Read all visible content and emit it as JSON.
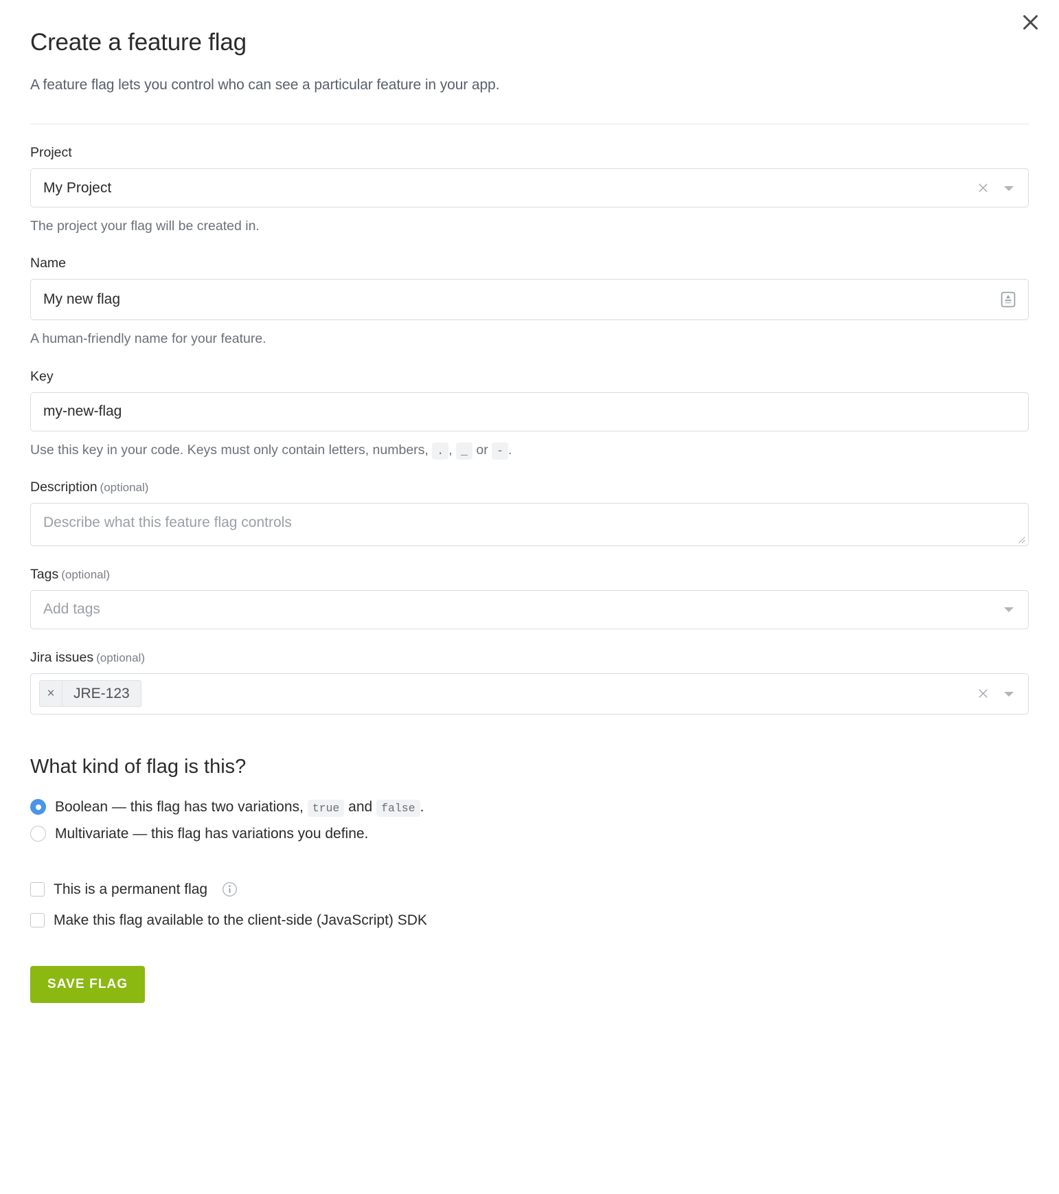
{
  "dialog": {
    "title": "Create a feature flag",
    "subtitle": "A feature flag lets you control who can see a particular feature in your app.",
    "close_label": "close-icon"
  },
  "project": {
    "label": "Project",
    "value": "My Project",
    "help": "The project your flag will be created in.",
    "clear_label": "×"
  },
  "name": {
    "label": "Name",
    "value": "My new flag",
    "help": "A human-friendly name for your feature."
  },
  "key": {
    "label": "Key",
    "value": "my-new-flag",
    "help_prefix": "Use this key in your code. Keys must only contain letters, numbers,",
    "chip_dot": ".",
    "help_comma": ",",
    "chip_underscore": "_",
    "help_or": "or",
    "chip_dash": "-",
    "help_suffix": "."
  },
  "description": {
    "label": "Description",
    "optional": "(optional)",
    "placeholder": "Describe what this feature flag controls",
    "value": ""
  },
  "tags": {
    "label": "Tags",
    "optional": "(optional)",
    "placeholder": "Add tags",
    "value": ""
  },
  "jira": {
    "label": "Jira issues",
    "optional": "(optional)",
    "token": "JRE-123",
    "token_remove": "×",
    "clear_label": "×",
    "value": ""
  },
  "flag_kind": {
    "heading": "What kind of flag is this?",
    "options": [
      {
        "id": "boolean",
        "selected": true,
        "text_before": "Boolean — this flag has two variations,",
        "code_true": "true",
        "text_middle": "and",
        "code_false": "false",
        "text_after": "."
      },
      {
        "id": "multivariate",
        "selected": false,
        "text_before": "Multivariate — this flag has variations you define.",
        "code_true": "",
        "text_middle": "",
        "code_false": "",
        "text_after": ""
      }
    ]
  },
  "checkboxes": [
    {
      "id": "permanent",
      "label": "This is a permanent flag",
      "checked": false,
      "has_info": true
    },
    {
      "id": "client-side",
      "label": "Make this flag available to the client-side (JavaScript) SDK",
      "checked": false,
      "has_info": false
    }
  ],
  "actions": {
    "save_label": "SAVE FLAG"
  },
  "colors": {
    "accent_green": "#8cb812",
    "radio_blue": "#4a94ea",
    "border": "#d8dbdf",
    "muted_text": "#6a7178"
  }
}
